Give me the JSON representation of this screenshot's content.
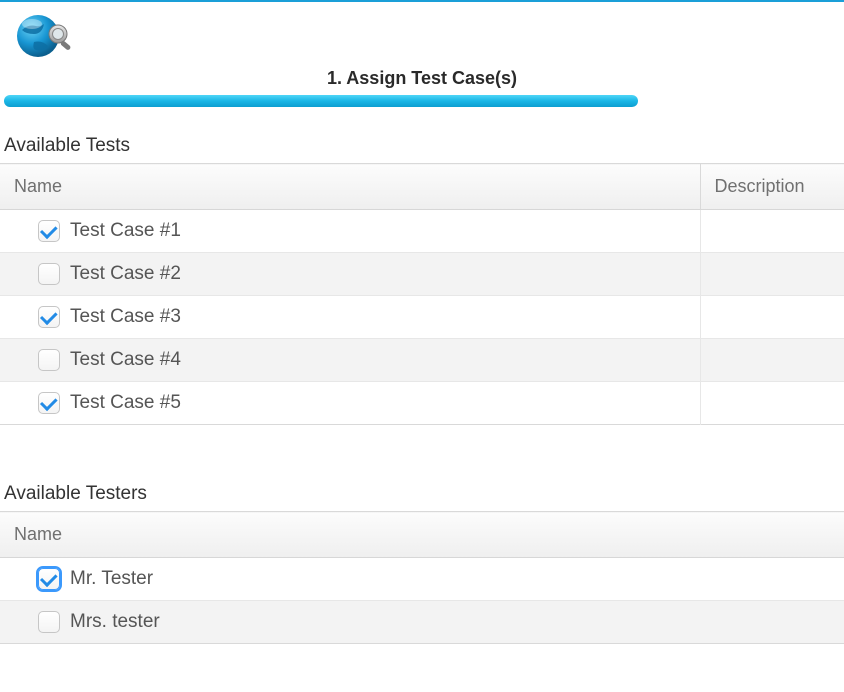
{
  "step": {
    "title": "1. Assign Test Case(s)"
  },
  "progress": {
    "percent": 85
  },
  "tests_section": {
    "title": "Available Tests",
    "columns": {
      "name": "Name",
      "description": "Description"
    },
    "rows": [
      {
        "checked": true,
        "name": "Test Case #1",
        "description": ""
      },
      {
        "checked": false,
        "name": "Test Case #2",
        "description": ""
      },
      {
        "checked": true,
        "name": "Test Case #3",
        "description": ""
      },
      {
        "checked": false,
        "name": "Test Case #4",
        "description": ""
      },
      {
        "checked": true,
        "name": "Test Case #5",
        "description": ""
      }
    ]
  },
  "testers_section": {
    "title": "Available Testers",
    "columns": {
      "name": "Name"
    },
    "rows": [
      {
        "checked": true,
        "focused": true,
        "name": "Mr. Tester"
      },
      {
        "checked": false,
        "focused": false,
        "name": "Mrs. tester"
      }
    ]
  }
}
